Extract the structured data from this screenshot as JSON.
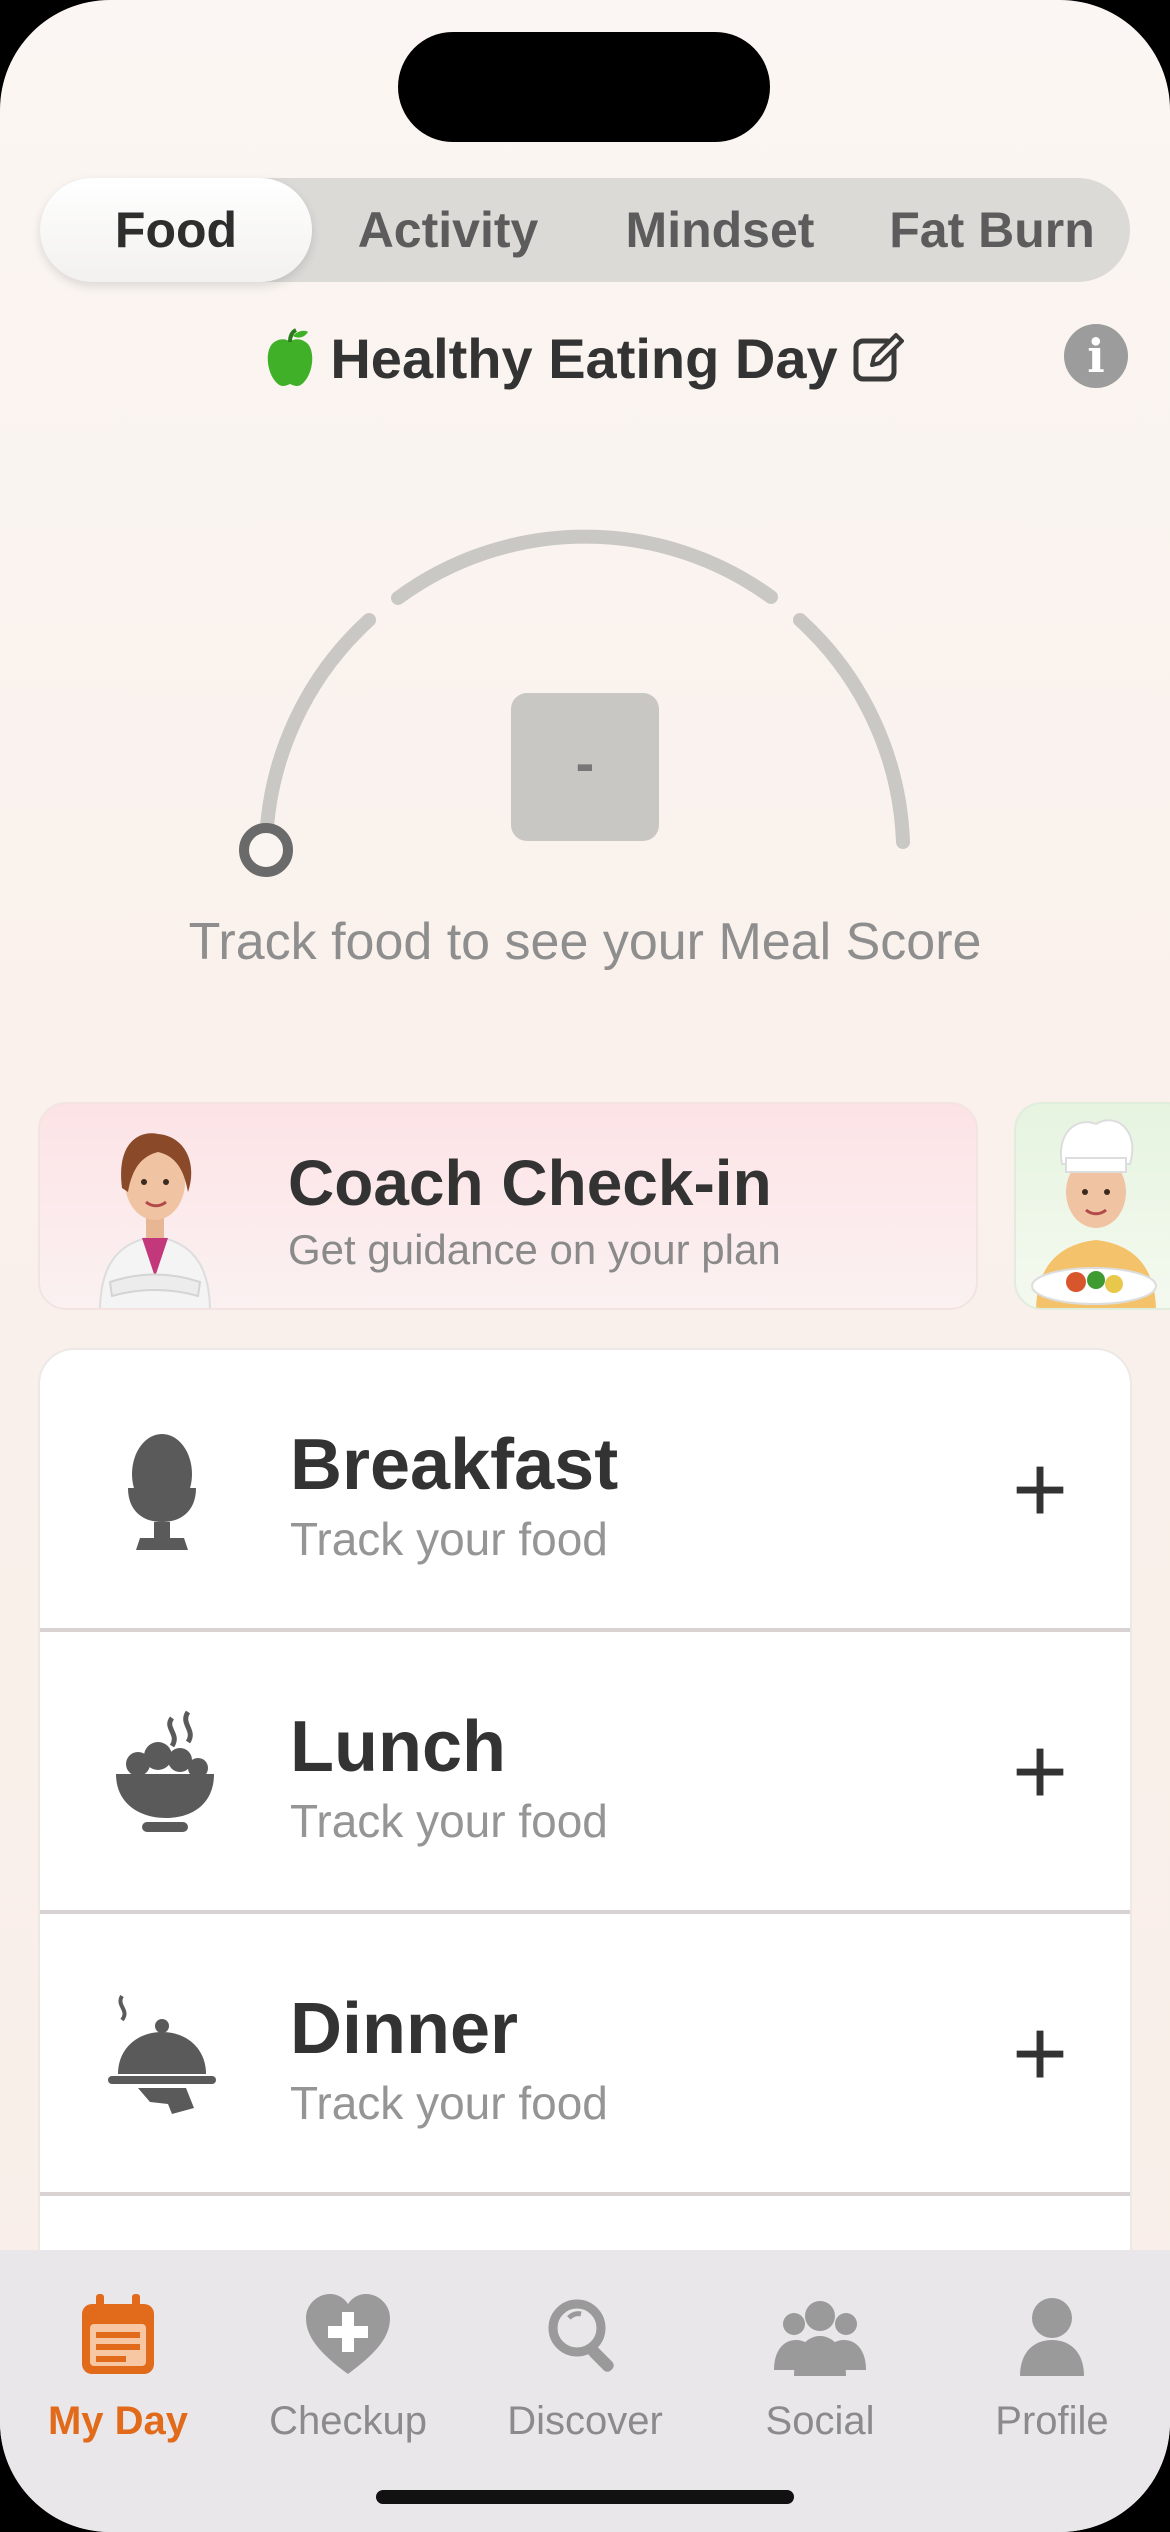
{
  "tabs": [
    {
      "label": "Food",
      "active": true
    },
    {
      "label": "Activity",
      "active": false
    },
    {
      "label": "Mindset",
      "active": false
    },
    {
      "label": "Fat Burn",
      "active": false
    }
  ],
  "day": {
    "title": "Healthy Eating Day",
    "icon": "apple-icon",
    "edit_icon": "edit-icon",
    "info_icon": "info-icon"
  },
  "gauge": {
    "score": "-",
    "caption": "Track food to see your Meal Score",
    "value": 0
  },
  "coach": {
    "title": "Coach Check-in",
    "subtitle": "Get guidance on your plan"
  },
  "meals": [
    {
      "name": "Breakfast",
      "subtitle": "Track your food",
      "icon": "egg-cup-icon"
    },
    {
      "name": "Lunch",
      "subtitle": "Track your food",
      "icon": "bowl-icon"
    },
    {
      "name": "Dinner",
      "subtitle": "Track your food",
      "icon": "cloche-icon"
    }
  ],
  "add_symbol": "+",
  "info_symbol": "i",
  "tabbar": [
    {
      "label": "My Day",
      "icon": "calendar-icon",
      "active": true
    },
    {
      "label": "Checkup",
      "icon": "heart-plus-icon",
      "active": false
    },
    {
      "label": "Discover",
      "icon": "magnifier-icon",
      "active": false
    },
    {
      "label": "Social",
      "icon": "group-icon",
      "active": false
    },
    {
      "label": "Profile",
      "icon": "person-icon",
      "active": false
    }
  ],
  "colors": {
    "accent": "#e26a1b",
    "apple": "#3fb028",
    "inactive": "#8b8b8b"
  }
}
